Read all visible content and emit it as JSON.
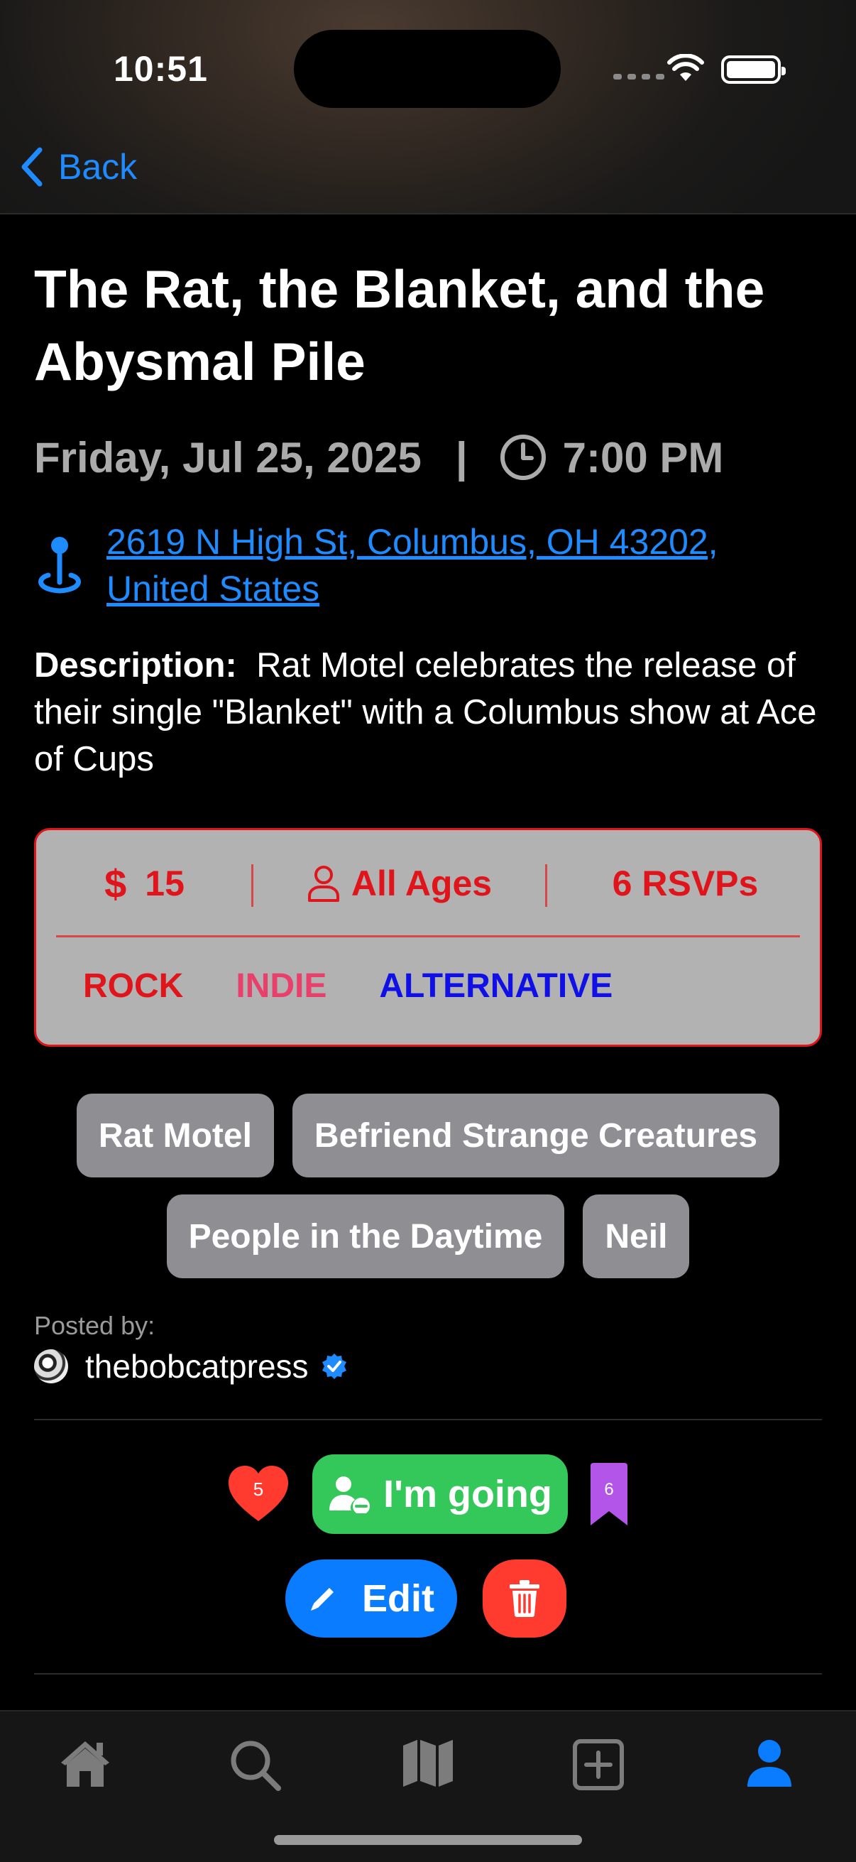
{
  "status_bar": {
    "time": "10:51"
  },
  "nav": {
    "back_label": "Back"
  },
  "event": {
    "title": "The Rat, the Blanket, and the Abysmal Pile",
    "date": "Friday, Jul 25, 2025",
    "separator": "|",
    "time": "7:00 PM",
    "address": "2619 N High St, Columbus, OH  43202, United States",
    "description_label": "Description:",
    "description": "Rat Motel celebrates the release of their single \"Blanket\" with a Columbus show at Ace of Cups"
  },
  "info": {
    "price": "15",
    "price_symbol": "$",
    "age": "All Ages",
    "rsvps": "6 RSVPs",
    "genres": [
      {
        "label": "ROCK",
        "color": "#e0151c"
      },
      {
        "label": "INDIE",
        "color": "#e8406a"
      },
      {
        "label": "ALTERNATIVE",
        "color": "#1010e6"
      }
    ],
    "accent_color": "#e0151c"
  },
  "artists": [
    "Rat Motel",
    "Befriend Strange Creatures",
    "People in the Daytime",
    "Neil"
  ],
  "posted": {
    "label": "Posted by:",
    "username": "thebobcatpress",
    "verified_icon": "verified-badge-icon"
  },
  "actions": {
    "likes_count": "5",
    "going_label": "I'm going",
    "bookmarks_count": "6",
    "edit_label": "Edit",
    "going_color": "#34c759",
    "edit_color": "#0a7cff",
    "delete_color": "#ff3b30",
    "bookmark_color": "#b355e8"
  },
  "tabbar": {
    "tabs": [
      "home-icon",
      "search-icon",
      "map-icon",
      "add-icon",
      "profile-icon"
    ],
    "active": "profile-icon",
    "active_color": "#0a7cff"
  }
}
